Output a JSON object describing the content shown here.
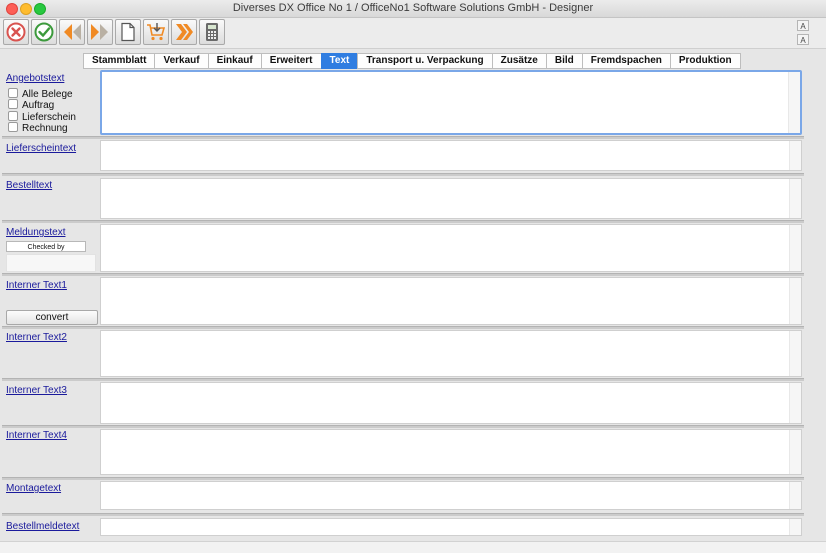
{
  "window": {
    "title": "Diverses DX Office No 1 /  OfficeNo1 Software Solutions GmbH - Designer"
  },
  "toolbar": {
    "buttons": [
      {
        "name": "cancel-icon",
        "color": "#d9534f"
      },
      {
        "name": "check-icon",
        "color": "#3c9a3c"
      },
      {
        "name": "double-left-arrow-icon",
        "color": "#f08a24"
      },
      {
        "name": "double-right-arrow-icon",
        "color": "#f08a24"
      },
      {
        "name": "new-document-icon",
        "color": "#666666"
      },
      {
        "name": "shopping-cart-icon",
        "color": "#f08a24"
      },
      {
        "name": "forward-icon",
        "color": "#f08a24"
      },
      {
        "name": "calculator-icon",
        "color": "#555555"
      }
    ],
    "side": {
      "font_larger": "A",
      "font_smaller": "A"
    }
  },
  "tabs": [
    "Stammblatt",
    "Verkauf",
    "Einkauf",
    "Erweitert",
    "Text",
    "Transport u. Verpackung",
    "Zusätze",
    "Bild",
    "Fremdspachen",
    "Produktion"
  ],
  "active_tab": "Text",
  "sections": {
    "angebotstext": {
      "label": "Angebotstext",
      "checkboxes": [
        "Alle Belege",
        "Auftrag",
        "Lieferschein",
        "Rechnung"
      ]
    },
    "lieferscheintext": {
      "label": "Lieferscheintext"
    },
    "bestelltext": {
      "label": "Bestelltext"
    },
    "meldungstext": {
      "label": "Meldungstext",
      "checked_by": "Checked by"
    },
    "interner1": {
      "label": "Interner Text1",
      "convert": "convert"
    },
    "interner2": {
      "label": "Interner Text2"
    },
    "interner3": {
      "label": "Interner Text3"
    },
    "interner4": {
      "label": "Interner Text4"
    },
    "montagetext": {
      "label": "Montagetext"
    },
    "bestellmeldetext": {
      "label": "Bestellmeldetext"
    }
  },
  "colors": {
    "accent": "#2f7de1",
    "link": "#1a1a9c",
    "focus": "#7aa7e8"
  }
}
